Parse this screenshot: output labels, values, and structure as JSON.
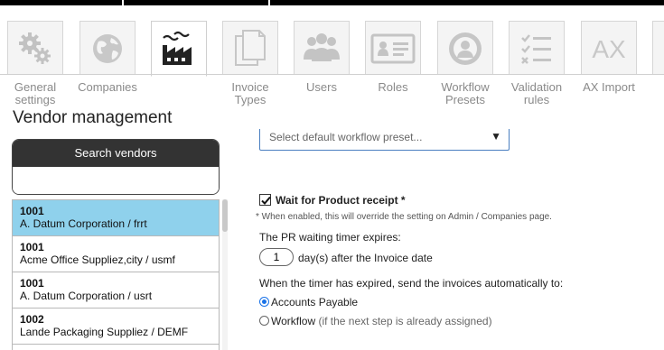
{
  "nav": {
    "items": [
      {
        "label": "General\nsettings",
        "icon": "gears-icon"
      },
      {
        "label": "Companies",
        "icon": "globe-icon"
      },
      {
        "label": "",
        "icon": "factory-icon",
        "active": true
      },
      {
        "label": "Invoice\nTypes",
        "icon": "documents-icon"
      },
      {
        "label": "Users",
        "icon": "users-icon"
      },
      {
        "label": "Roles",
        "icon": "id-card-icon"
      },
      {
        "label": "Workflow\nPresets",
        "icon": "user-gear-icon"
      },
      {
        "label": "Validation\nrules",
        "icon": "checklist-icon"
      },
      {
        "label": "AX Import",
        "icon": "ax-icon"
      }
    ],
    "ax_text": "AX"
  },
  "page": {
    "title": "Vendor management"
  },
  "search": {
    "header": "Search vendors",
    "value": ""
  },
  "vendors": [
    {
      "id": "1001",
      "name": "A. Datum Corporation / frrt",
      "selected": true
    },
    {
      "id": "1001",
      "name": "Acme Office Suppliez,city / usmf"
    },
    {
      "id": "1001",
      "name": "A. Datum Corporation / usrt"
    },
    {
      "id": "1002",
      "name": "Lande Packaging Suppliez / DEMF"
    }
  ],
  "settings": {
    "preset_placeholder": "Select default workflow preset...",
    "wait_label": "Wait for Product receipt *",
    "wait_checked": true,
    "wait_note": "* When enabled, this will override the setting on Admin / Companies page.",
    "timer_label": "The PR waiting timer expires:",
    "days_value": "1",
    "days_suffix": "day(s) after the Invoice date",
    "send_label": "When the timer has expired, send the invoices automatically to:",
    "options": [
      {
        "label": "Accounts Payable",
        "hint": "",
        "checked": true
      },
      {
        "label": "Workflow",
        "hint": " (if the next step is already assigned)",
        "checked": false
      }
    ]
  },
  "colors": {
    "selected_row": "#8fd1ec",
    "search_header": "#333333",
    "radio_accent": "#1a73e8"
  }
}
